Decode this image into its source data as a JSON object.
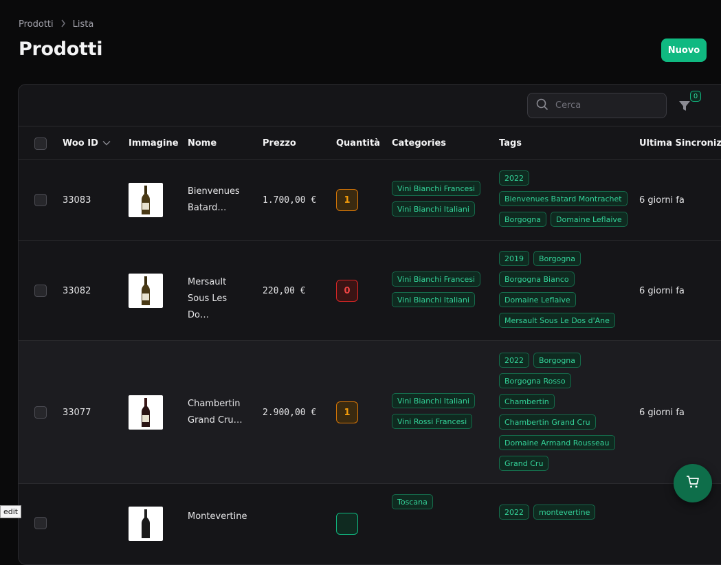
{
  "breadcrumb": {
    "items": [
      "Prodotti",
      "Lista"
    ]
  },
  "page": {
    "title": "Prodotti",
    "new_label": "Nuovo"
  },
  "search": {
    "placeholder": "Cerca"
  },
  "filter": {
    "count": "0"
  },
  "columns": {
    "woo_id": "Woo ID",
    "image": "Immagine",
    "name": "Nome",
    "price": "Prezzo",
    "quantity": "Quantità",
    "categories": "Categories",
    "tags": "Tags",
    "last_sync": "Ultima Sincroniz"
  },
  "rows": [
    {
      "woo_id": "33083",
      "name_line1": "Bienvenues",
      "name_line2": "Batard…",
      "price": "1.700,00 €",
      "quantity": "1",
      "categories": [
        "Vini Bianchi Francesi",
        "Vini Bianchi Italiani"
      ],
      "tags": [
        "2022",
        "Bienvenues Batard Montrachet",
        "Borgogna",
        "Domaine Leflaive"
      ],
      "last_sync": "6 giorni fa"
    },
    {
      "woo_id": "33082",
      "name_line1": "Mersault",
      "name_line2": "Sous Les Do…",
      "price": "220,00 €",
      "quantity": "0",
      "categories": [
        "Vini Bianchi Francesi",
        "Vini Bianchi Italiani"
      ],
      "tags": [
        "2019",
        "Borgogna",
        "Borgogna Bianco",
        "Domaine Leflaive",
        "Mersault Sous Le Dos d'Ane"
      ],
      "last_sync": "6 giorni fa"
    },
    {
      "woo_id": "33077",
      "name_line1": "Chambertin",
      "name_line2": "Grand Cru…",
      "price": "2.900,00 €",
      "quantity": "1",
      "categories": [
        "Vini Bianchi Italiani",
        "Vini Rossi Francesi"
      ],
      "tags": [
        "2022",
        "Borgogna",
        "Borgogna Rosso",
        "Chambertin",
        "Chambertin Grand Cru",
        "Domaine Armand Rousseau",
        "Grand Cru"
      ],
      "last_sync": "6 giorni fa"
    },
    {
      "woo_id": "",
      "name_line1": "Montevertine",
      "name_line2": "",
      "price": "",
      "quantity": "",
      "categories": [
        "Toscana"
      ],
      "tags": [
        "2022",
        "montevertine"
      ],
      "last_sync": ""
    }
  ],
  "footer": {
    "edit_label": "edit"
  }
}
